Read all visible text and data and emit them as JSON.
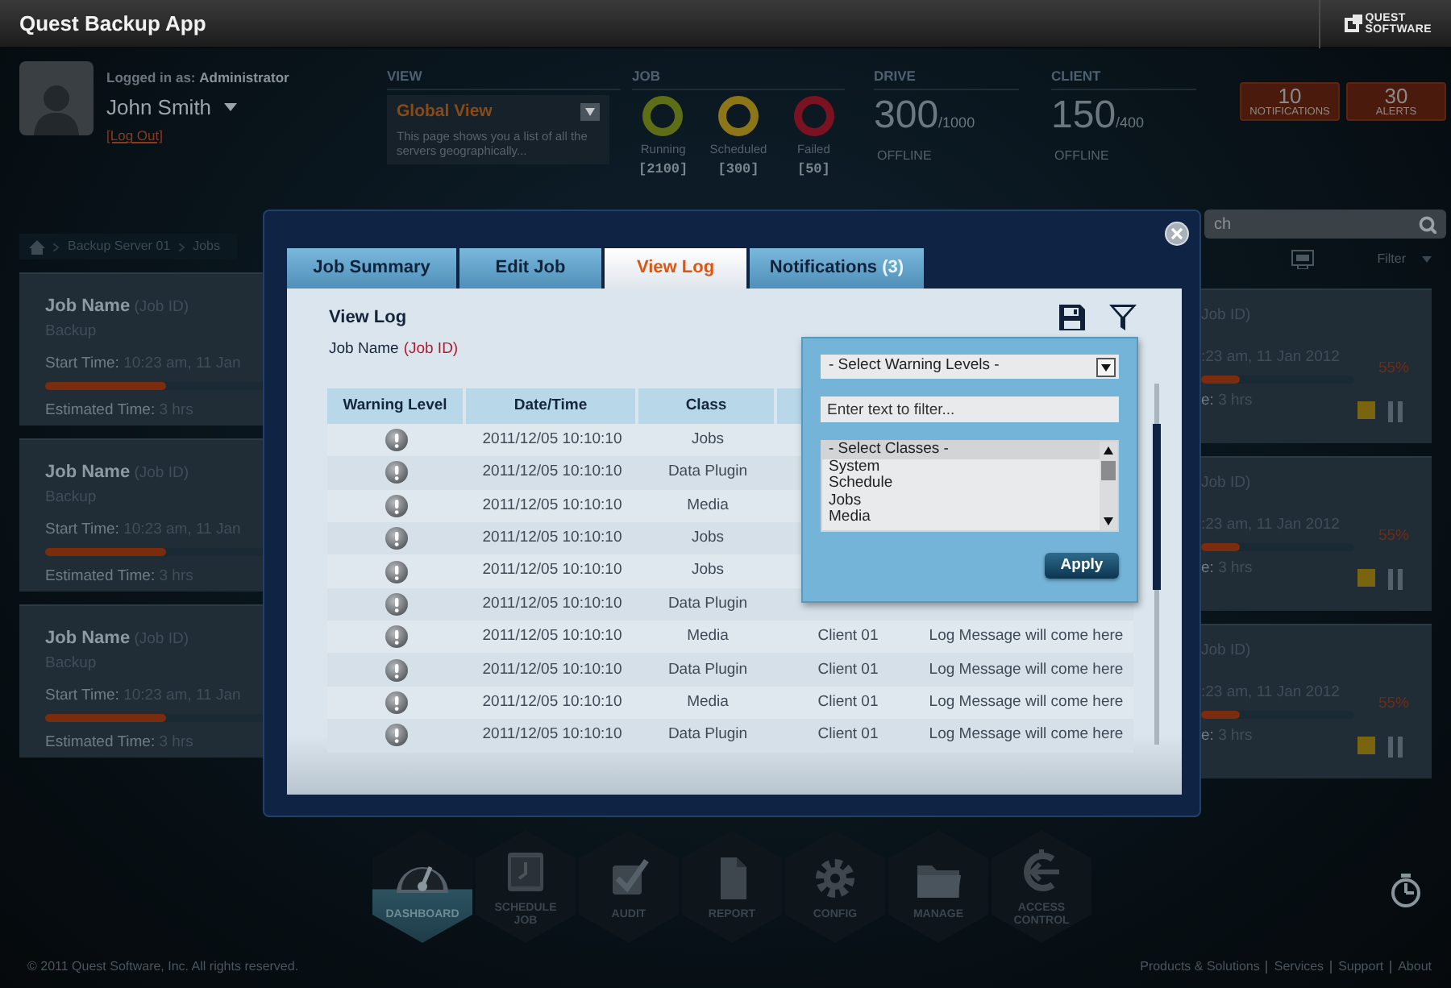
{
  "app": {
    "title": "Quest Backup App",
    "logo_lines": [
      "QUEST",
      "SOFTWARE"
    ]
  },
  "user": {
    "logged_in_label": "Logged in as:",
    "role": "Administrator",
    "name": "John Smith",
    "logout": "[Log Out]"
  },
  "view": {
    "heading": "VIEW",
    "selected": "Global View",
    "description": "This page shows you a list of all the servers geographically..."
  },
  "job": {
    "heading": "JOB",
    "statuses": [
      {
        "label": "Running",
        "count": "[2100]",
        "color": "#5e6e16"
      },
      {
        "label": "Scheduled",
        "count": "[300]",
        "color": "#8c7617"
      },
      {
        "label": "Failed",
        "count": "[50]",
        "color": "#7a1222"
      }
    ]
  },
  "drive": {
    "heading": "DRIVE",
    "value": "300",
    "total": "/1000",
    "status": "OFFLINE"
  },
  "client": {
    "heading": "CLIENT",
    "value": "150",
    "total": "/400",
    "status": "OFFLINE"
  },
  "badges": [
    {
      "count": "10",
      "label": "NOTIFICATIONS"
    },
    {
      "count": "30",
      "label": "ALERTS"
    }
  ],
  "search": {
    "placeholder": "ch"
  },
  "breadcrumb": [
    "Backup Server 01",
    "Jobs"
  ],
  "filter_label": "Filter",
  "left_cards": [
    {
      "name": "Job Name",
      "id": "(Job ID)",
      "type": "Backup",
      "start_label": "Start Time:",
      "start_value": "10:23 am, 11 Jan",
      "level": 0.55,
      "estimate_label": "Estimated Time:",
      "estimate_value": "3 hrs"
    },
    {
      "name": "Job Name",
      "id": "(Job ID)",
      "type": "Backup",
      "start_label": "Start Time:",
      "start_value": "10:23 am, 11 Jan",
      "level": 0.55,
      "estimate_label": "Estimated Time:",
      "estimate_value": "3 hrs"
    },
    {
      "name": "Job Name",
      "id": "(Job ID)",
      "type": "Backup",
      "start_label": "Start Time:",
      "start_value": "10:23 am, 11 Jan",
      "level": 0.55,
      "estimate_label": "Estimated Time:",
      "estimate_value": "3 hrs"
    }
  ],
  "right_cards": [
    {
      "id": "Job ID)",
      "start": ":23 am, 11 Jan 2012",
      "level": 0.25,
      "percent": "55%",
      "estimate_label": "e:",
      "estimate_value": "3 hrs"
    },
    {
      "id": "Job ID)",
      "start": ":23 am, 11 Jan 2012",
      "level": 0.25,
      "percent": "55%",
      "estimate_label": "e:",
      "estimate_value": "3 hrs"
    },
    {
      "id": "Job ID)",
      "start": ":23 am, 11 Jan 2012",
      "level": 0.25,
      "percent": "55%",
      "estimate_label": "e:",
      "estimate_value": "3 hrs"
    }
  ],
  "modal": {
    "tabs": [
      {
        "label": "Job Summary",
        "selected": false
      },
      {
        "label": "Edit Job",
        "selected": false
      },
      {
        "label": "View Log",
        "selected": true
      },
      {
        "label": "Notifications",
        "count": "(3)",
        "selected": false
      }
    ],
    "title": "View Log",
    "job_name": "Job Name",
    "job_id": "(Job ID)",
    "table": {
      "columns": [
        "Warning Level",
        "Date/Time",
        "Class"
      ],
      "rows": [
        {
          "datetime": "2011/12/05 10:10:10",
          "class": "Jobs"
        },
        {
          "datetime": "2011/12/05 10:10:10",
          "class": "Data Plugin"
        },
        {
          "datetime": "2011/12/05 10:10:10",
          "class": "Media"
        },
        {
          "datetime": "2011/12/05 10:10:10",
          "class": "Jobs"
        },
        {
          "datetime": "2011/12/05 10:10:10",
          "class": "Jobs"
        },
        {
          "datetime": "2011/12/05 10:10:10",
          "class": "Data Plugin"
        },
        {
          "datetime": "2011/12/05 10:10:10",
          "class": "Media",
          "client": "Client 01",
          "message": "Log Message will come here"
        },
        {
          "datetime": "2011/12/05 10:10:10",
          "class": "Data Plugin",
          "client": "Client 01",
          "message": "Log Message will come here"
        },
        {
          "datetime": "2011/12/05 10:10:10",
          "class": "Media",
          "client": "Client 01",
          "message": "Log Message will come here"
        },
        {
          "datetime": "2011/12/05 10:10:10",
          "class": "Data Plugin",
          "client": "Client 01",
          "message": "Log Message will come here"
        }
      ]
    },
    "filter": {
      "warning_select": "- Select Warning Levels -",
      "text_placeholder": "Enter text to filter...",
      "classes": [
        {
          "label": "- Select Classes -",
          "selected": true
        },
        {
          "label": "System",
          "selected": false
        },
        {
          "label": "Schedule",
          "selected": false
        },
        {
          "label": "Jobs",
          "selected": false
        },
        {
          "label": "Media",
          "selected": false
        }
      ],
      "apply": "Apply"
    }
  },
  "nav": [
    {
      "label": "DASHBOARD",
      "kind": "gauge",
      "selected": true
    },
    {
      "label": "SCHEDULE JOB",
      "kind": "calendar",
      "selected": false
    },
    {
      "label": "AUDIT",
      "kind": "check",
      "selected": false
    },
    {
      "label": "REPORT",
      "kind": "document",
      "selected": false
    },
    {
      "label": "CONFIG",
      "kind": "gear",
      "selected": false
    },
    {
      "label": "MANAGE",
      "kind": "folder",
      "selected": false
    },
    {
      "label": "ACCESS CONTROL",
      "kind": "access",
      "selected": false
    }
  ],
  "footer": {
    "copyright": "© 2011 Quest Software, Inc. All rights reserved.",
    "links": [
      "Products & Solutions",
      "Services",
      "Support",
      "About"
    ]
  }
}
